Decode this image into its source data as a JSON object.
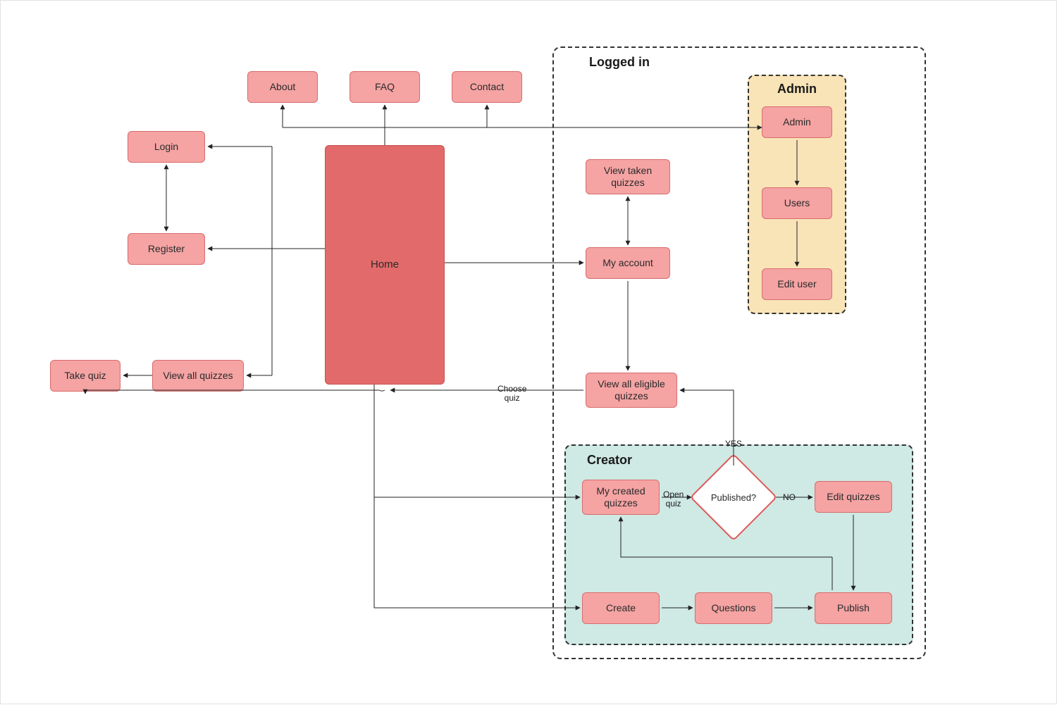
{
  "nodes": {
    "about": "About",
    "faq": "FAQ",
    "contact": "Contact",
    "login": "Login",
    "register": "Register",
    "home": "Home",
    "take_quiz": "Take quiz",
    "view_all_quizzes": "View all quizzes",
    "my_account": "My account",
    "view_taken": "View taken\nquizzes",
    "view_eligible": "View all eligible\nquizzes",
    "admin": "Admin",
    "users": "Users",
    "edit_user": "Edit user",
    "my_created": "My created\nquizzes",
    "edit_quizzes": "Edit quizzes",
    "create": "Create",
    "questions": "Questions",
    "publish": "Publish",
    "published_q": "Published?"
  },
  "groups": {
    "logged_in": "Logged in",
    "admin": "Admin",
    "creator": "Creator"
  },
  "labels": {
    "choose_quiz": "Choose\nquiz",
    "open_quiz": "Open\nquiz",
    "yes": "YES",
    "no": "NO"
  }
}
